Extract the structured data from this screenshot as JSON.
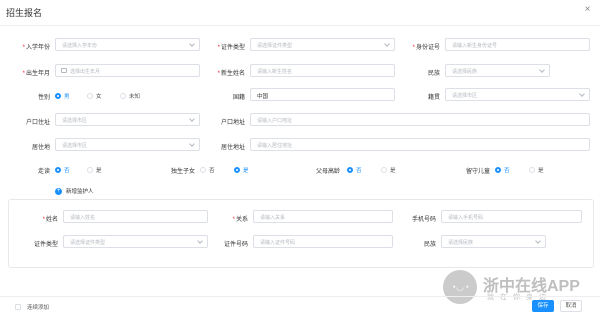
{
  "dialog": {
    "title": "招生报名",
    "close_glyph": "×"
  },
  "form": {
    "enroll_year": {
      "label": "入学年份",
      "placeholder": "请选择入学年份"
    },
    "id_type": {
      "label": "证件类型",
      "placeholder": "请选择证件类型"
    },
    "id_number": {
      "label": "身份证号",
      "placeholder": "请输入新生身份证号"
    },
    "birth": {
      "label": "出生年月",
      "placeholder": "选择出生年月"
    },
    "name": {
      "label": "新生姓名",
      "placeholder": "请输入新生姓名"
    },
    "ethnicity": {
      "label": "民族",
      "placeholder": "请选择民族"
    },
    "gender": {
      "label": "性别",
      "options": [
        "男",
        "女",
        "未知"
      ],
      "selected": "男"
    },
    "nationality": {
      "label": "国籍",
      "value": "中国"
    },
    "native_place": {
      "label": "籍贯",
      "placeholder": "请选择市区"
    },
    "hukou_place": {
      "label": "户口住址",
      "placeholder": "请选择市区"
    },
    "hukou_address": {
      "label": "户口地址",
      "placeholder": "请输入户口地址"
    },
    "residence": {
      "label": "居住地",
      "placeholder": "请选择市区"
    },
    "residence_address": {
      "label": "居住地址",
      "placeholder": "请输入居住地址"
    },
    "boarding": {
      "label": "走读",
      "options": [
        "否",
        "是"
      ],
      "selected": "否"
    },
    "only_child": {
      "label": "独生子女",
      "options": [
        "否",
        "是"
      ],
      "selected": "是"
    },
    "elderly_parents": {
      "label": "父母高龄",
      "options": [
        "否",
        "是"
      ],
      "selected": "否"
    },
    "left_behind": {
      "label": "留守儿童",
      "options": [
        "否",
        "是"
      ],
      "selected": "否"
    },
    "add_guardian": "新增监护人"
  },
  "guardian": {
    "name": {
      "label": "姓名",
      "placeholder": "请输入姓名"
    },
    "relation": {
      "label": "关系",
      "placeholder": "请输入关系"
    },
    "phone": {
      "label": "手机号码",
      "placeholder": "请输入手机号码"
    },
    "id_type": {
      "label": "证件类型",
      "placeholder": "请选择证件类型"
    },
    "id_number": {
      "label": "证件号码",
      "placeholder": "请输入证件号码"
    },
    "ethnicity": {
      "label": "民族",
      "placeholder": "请选择民族"
    }
  },
  "footer": {
    "continue_add": "连续添加",
    "save": "保存",
    "cancel": "取消"
  },
  "watermark": {
    "brand": "浙中在线APP",
    "slogan": "就在你身边"
  },
  "colors": {
    "primary": "#1890ff",
    "required": "#f5222d",
    "border": "#dcdfe6"
  }
}
